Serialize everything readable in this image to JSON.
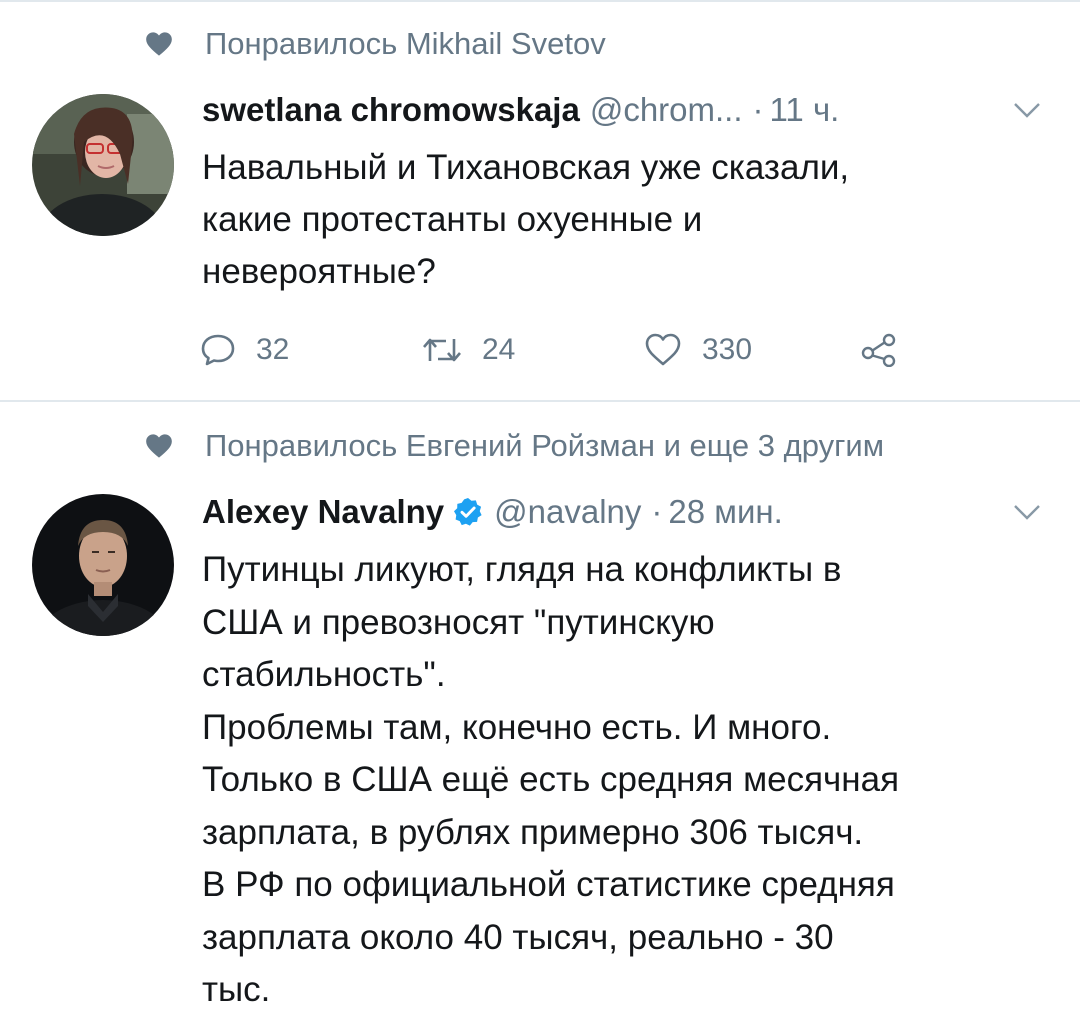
{
  "tweets": [
    {
      "social_context": "Понравилось Mikhail Svetov",
      "author_name": "swetlana chromowskaja",
      "handle": "@chrom...",
      "separator": "·",
      "time": "11 ч.",
      "verified": false,
      "text": "Навальный и Тихановская уже сказали,\nкакие протестанты охуенные и\nневероятные?",
      "replies": "32",
      "retweets": "24",
      "likes": "330",
      "share_icon": "share-icon"
    },
    {
      "social_context": "Понравилось Евгений Ройзман и еще 3 другим",
      "author_name": "Alexey Navalny",
      "handle": "@navalny",
      "separator": "·",
      "time": "28 мин.",
      "verified": true,
      "text": "Путинцы ликуют, глядя на конфликты в\nСША и превозносят \"путинскую\nстабильность\".\nПроблемы там, конечно есть. И много.\nТолько в США ещё есть средняя месячная\nзарплата, в рублях примерно 306 тысяч.\nВ РФ по официальной статистике средняя\nзарплата около 40 тысяч, реально - 30\nтыс."
    }
  ],
  "colors": {
    "text": "#14171a",
    "muted": "#657786",
    "divider": "#e1e8ed",
    "verified_blue": "#1da1f2"
  }
}
